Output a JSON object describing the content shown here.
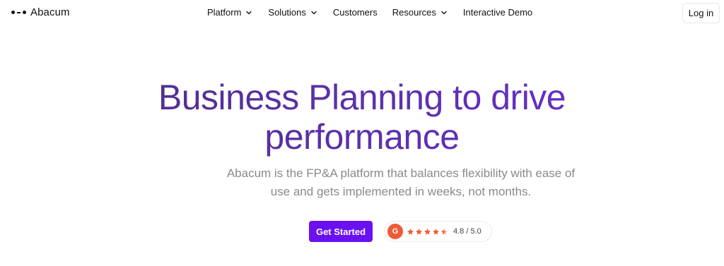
{
  "brand": {
    "name": "Abacum"
  },
  "nav": {
    "items": [
      {
        "label": "Platform",
        "has_dropdown": true
      },
      {
        "label": "Solutions",
        "has_dropdown": true
      },
      {
        "label": "Customers",
        "has_dropdown": false
      },
      {
        "label": "Resources",
        "has_dropdown": true
      },
      {
        "label": "Interactive Demo",
        "has_dropdown": false
      }
    ],
    "login_label": "Log in"
  },
  "hero": {
    "title_line1": "Business Planning to drive",
    "title_line2": "performance",
    "subtitle": "Abacum is the FP&A platform that balances flexibility with ease of use and gets implemented in weeks, not months.",
    "cta_label": "Get Started"
  },
  "rating": {
    "badge_letter": "G",
    "score_text": "4.8 / 5.0",
    "stars": 4.5,
    "badge_color": "#f05a35"
  },
  "colors": {
    "accent": "#6b10f0",
    "title_gradient_start": "#4a2e7e",
    "title_gradient_end": "#6a2fd6",
    "subtitle": "#8a8a8a"
  },
  "icons": {
    "logo": "abacus-dots-icon",
    "dropdown": "chevron-down-icon",
    "star": "star-icon",
    "g2": "g2-logo-icon"
  }
}
